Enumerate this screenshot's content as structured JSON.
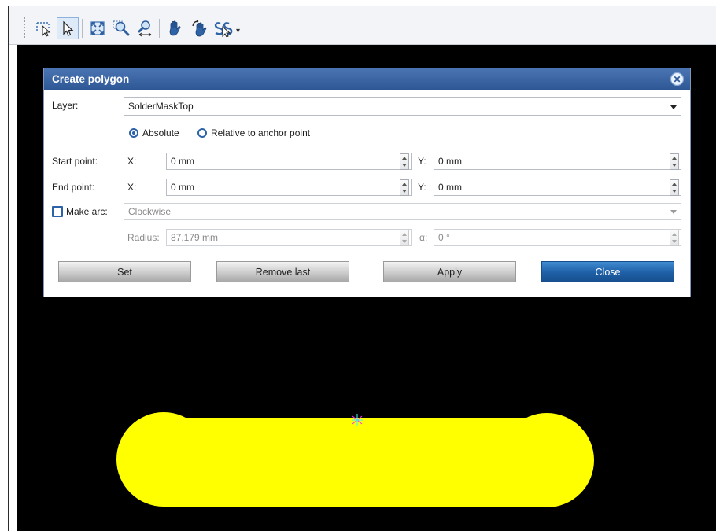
{
  "toolbar": {
    "tools": [
      {
        "name": "lasso-select-icon"
      },
      {
        "name": "pointer-select-icon",
        "active": true
      },
      {
        "name": "zoom-fit-icon"
      },
      {
        "name": "zoom-area-icon"
      },
      {
        "name": "zoom-horizontal-icon"
      },
      {
        "name": "pan-hand-icon"
      },
      {
        "name": "rotate-hand-icon"
      },
      {
        "name": "snap-menu-icon"
      }
    ]
  },
  "dialog": {
    "title": "Create polygon",
    "layer_label": "Layer:",
    "layer_value": "SolderMaskTop",
    "mode_absolute": "Absolute",
    "mode_relative": "Relative to anchor point",
    "selected_mode": "Absolute",
    "start_label": "Start point:",
    "end_label": "End point:",
    "x_label": "X:",
    "y_label": "Y:",
    "start_x": "0 mm",
    "start_y": "0 mm",
    "end_x": "0 mm",
    "end_y": "0 mm",
    "make_arc_label": "Make arc:",
    "make_arc_checked": false,
    "arc_direction": "Clockwise",
    "radius_label": "Radius:",
    "radius_value": "87,179 mm",
    "alpha_label": "α:",
    "alpha_value": "0 °",
    "buttons": {
      "set": "Set",
      "remove_last": "Remove last",
      "apply": "Apply",
      "close": "Close"
    }
  },
  "colors": {
    "canvas_bg": "#000000",
    "shape_fill": "#ffff00",
    "title_bar": "#2e5795",
    "accent": "#2c62a8",
    "close_button": "#1e5fa6"
  }
}
